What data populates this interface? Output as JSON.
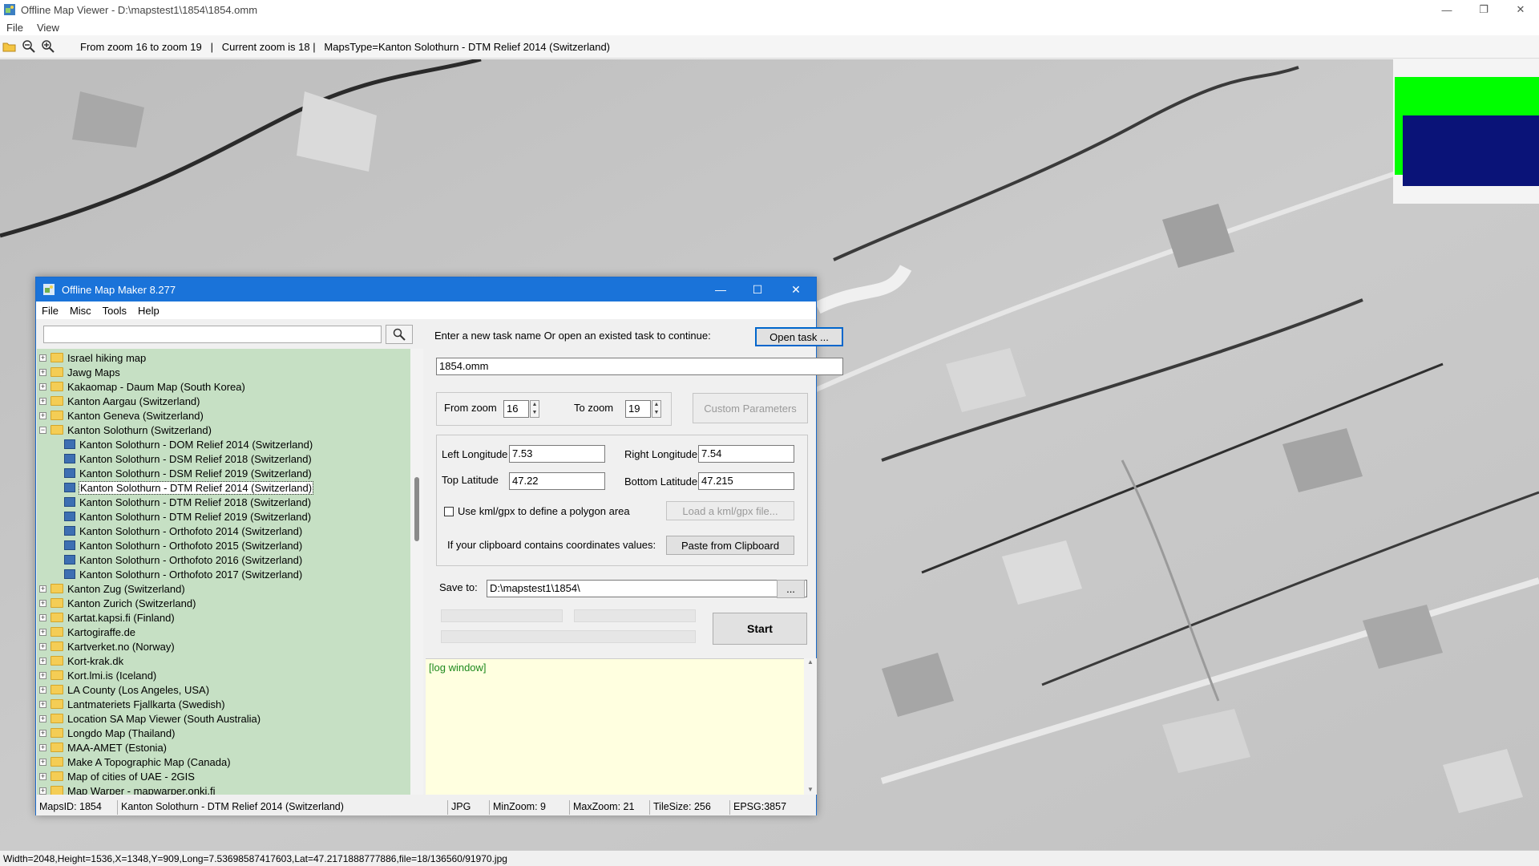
{
  "viewer": {
    "title": "Offline Map Viewer - D:\\mapstest1\\1854\\1854.omm",
    "menu": [
      "File",
      "View"
    ],
    "toolbar_status": "From zoom 16 to zoom 19   |   Current zoom is 18 |   MapsType=Kanton Solothurn - DTM Relief 2014 (Switzerland)",
    "statusbar": "Width=2048,Height=1536,X=1348,Y=909,Long=7.53698587417603,Lat=47.2171888777886,file=18/136560/91970.jpg"
  },
  "dialog": {
    "title": "Offline Map Maker 8.277",
    "menu": [
      "File",
      "Misc",
      "Tools",
      "Help"
    ],
    "search_placeholder": "",
    "tree": [
      {
        "label": "Israel hiking map",
        "type": "folder",
        "level": 0
      },
      {
        "label": "Jawg Maps",
        "type": "folder",
        "level": 0
      },
      {
        "label": "Kakaomap - Daum Map (South Korea)",
        "type": "folder",
        "level": 0
      },
      {
        "label": "Kanton Aargau (Switzerland)",
        "type": "folder",
        "level": 0
      },
      {
        "label": "Kanton Geneva (Switzerland)",
        "type": "folder",
        "level": 0
      },
      {
        "label": "Kanton Solothurn (Switzerland)",
        "type": "folder-open",
        "level": 0
      },
      {
        "label": "Kanton Solothurn - DOM Relief 2014 (Switzerland)",
        "type": "map",
        "level": 1
      },
      {
        "label": "Kanton Solothurn - DSM Relief 2018 (Switzerland)",
        "type": "map",
        "level": 1
      },
      {
        "label": "Kanton Solothurn - DSM Relief 2019 (Switzerland)",
        "type": "map",
        "level": 1
      },
      {
        "label": "Kanton Solothurn - DTM Relief 2014 (Switzerland)",
        "type": "map",
        "level": 1,
        "selected": true
      },
      {
        "label": "Kanton Solothurn - DTM Relief 2018 (Switzerland)",
        "type": "map",
        "level": 1
      },
      {
        "label": "Kanton Solothurn - DTM Relief 2019 (Switzerland)",
        "type": "map",
        "level": 1
      },
      {
        "label": "Kanton Solothurn - Orthofoto 2014 (Switzerland)",
        "type": "map",
        "level": 1
      },
      {
        "label": "Kanton Solothurn - Orthofoto 2015 (Switzerland)",
        "type": "map",
        "level": 1
      },
      {
        "label": "Kanton Solothurn - Orthofoto 2016 (Switzerland)",
        "type": "map",
        "level": 1
      },
      {
        "label": "Kanton Solothurn - Orthofoto 2017 (Switzerland)",
        "type": "map",
        "level": 1
      },
      {
        "label": "Kanton Zug (Switzerland)",
        "type": "folder",
        "level": 0
      },
      {
        "label": "Kanton Zurich (Switzerland)",
        "type": "folder",
        "level": 0
      },
      {
        "label": "Kartat.kapsi.fi (Finland)",
        "type": "folder",
        "level": 0
      },
      {
        "label": "Kartogiraffe.de",
        "type": "folder",
        "level": 0
      },
      {
        "label": "Kartverket.no (Norway)",
        "type": "folder",
        "level": 0
      },
      {
        "label": "Kort-krak.dk",
        "type": "folder",
        "level": 0
      },
      {
        "label": "Kort.lmi.is (Iceland)",
        "type": "folder",
        "level": 0
      },
      {
        "label": "LA County (Los Angeles, USA)",
        "type": "folder",
        "level": 0
      },
      {
        "label": "Lantmateriets Fjallkarta (Swedish)",
        "type": "folder",
        "level": 0
      },
      {
        "label": "Location SA Map Viewer (South Australia)",
        "type": "folder",
        "level": 0
      },
      {
        "label": "Longdo Map (Thailand)",
        "type": "folder",
        "level": 0
      },
      {
        "label": "MAA-AMET (Estonia)",
        "type": "folder",
        "level": 0
      },
      {
        "label": "Make A Topographic Map (Canada)",
        "type": "folder",
        "level": 0
      },
      {
        "label": "Map of cities of UAE - 2GIS",
        "type": "folder",
        "level": 0
      },
      {
        "label": "Map Warper - mapwarper.onki.fi",
        "type": "folder",
        "level": 0
      }
    ],
    "task_prompt": "Enter a new task name Or open an existed task to continue:",
    "open_task_label": "Open task ...",
    "task_name": "1854.omm",
    "from_zoom_label": "From zoom",
    "from_zoom": "16",
    "to_zoom_label": "To zoom",
    "to_zoom": "19",
    "custom_params_label": "Custom Parameters",
    "left_lon_label": "Left Longitude",
    "left_lon": "7.53",
    "right_lon_label": "Right Longitude",
    "right_lon": "7.54",
    "top_lat_label": "Top Latitude",
    "top_lat": "47.22",
    "bottom_lat_label": "Bottom Latitude",
    "bottom_lat": "47.215",
    "kml_checkbox_label": "Use kml/gpx to define a polygon area",
    "kml_checked": false,
    "load_kml_label": "Load a kml/gpx file...",
    "clipboard_prompt": "If your clipboard contains coordinates values:",
    "paste_label": "Paste from Clipboard",
    "save_to_label": "Save to:",
    "save_to": "D:\\mapstest1\\1854\\",
    "browse_label": "...",
    "start_label": "Start",
    "log_text": "[log window]",
    "status": {
      "maps_id": "MapsID: 1854",
      "maps_name": "Kanton Solothurn - DTM Relief 2014 (Switzerland)",
      "format": "JPG",
      "min_zoom": "MinZoom: 9",
      "max_zoom": "MaxZoom: 21",
      "tile_size": "TileSize: 256",
      "epsg": "EPSG:3857"
    }
  },
  "overview_colors": {
    "frame": "#00ff00",
    "viewport": "#0a1378"
  }
}
